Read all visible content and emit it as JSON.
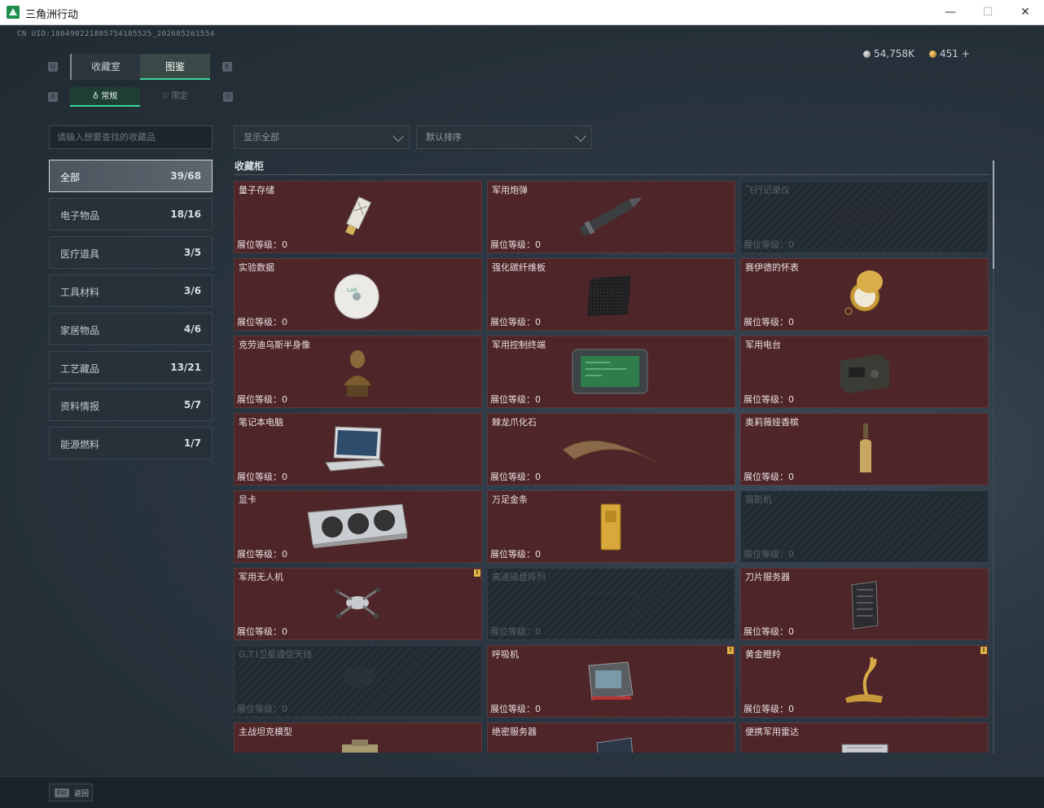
{
  "window": {
    "title": "三角洲行动",
    "minimize": "—",
    "maximize": "☐",
    "close": "✕"
  },
  "uid": "CN UID:1864902218057541055​25_202605261554",
  "currency": [
    {
      "icon": "silver-coin-icon",
      "value": "54,758K"
    },
    {
      "icon": "gold-coin-icon",
      "value": "451 +"
    }
  ],
  "tabs": {
    "main": [
      "收藏室",
      "图鉴"
    ],
    "main_active": 1,
    "sub": [
      "常规",
      "限定"
    ],
    "sub_active": 0,
    "hint_left": "Q",
    "hint_right": "E",
    "hint_left2": "A",
    "hint_right2": "D"
  },
  "search": {
    "placeholder": "请输入想要查找的收藏品"
  },
  "filters": {
    "display": "显示全部",
    "sort": "默认排序"
  },
  "categories": [
    {
      "label": "全部",
      "count": "39/68",
      "active": true
    },
    {
      "label": "电子物品",
      "count": "18/16"
    },
    {
      "label": "医疗道具",
      "count": "3/5"
    },
    {
      "label": "工具材料",
      "count": "3/6"
    },
    {
      "label": "家居物品",
      "count": "4/6"
    },
    {
      "label": "工艺藏品",
      "count": "13/21"
    },
    {
      "label": "资料情报",
      "count": "5/7"
    },
    {
      "label": "能源燃料",
      "count": "1/7"
    }
  ],
  "section": {
    "title": "收藏柜"
  },
  "level_label": "展位等级：0",
  "items": [
    {
      "name": "量子存储",
      "unlocked": true,
      "badge": false,
      "icon": "usb-drive-icon"
    },
    {
      "name": "军用炮弹",
      "unlocked": true,
      "badge": false,
      "icon": "artillery-shell-icon"
    },
    {
      "name": "飞行记录仪",
      "unlocked": false,
      "badge": false,
      "icon": "flight-recorder-icon"
    },
    {
      "name": "实验数据",
      "unlocked": true,
      "badge": false,
      "icon": "disc-icon"
    },
    {
      "name": "强化碳纤维板",
      "unlocked": true,
      "badge": false,
      "icon": "carbon-plate-icon"
    },
    {
      "name": "赛伊德的怀表",
      "unlocked": true,
      "badge": false,
      "icon": "pocket-watch-icon"
    },
    {
      "name": "克劳迪乌斯半身像",
      "unlocked": true,
      "badge": false,
      "icon": "bust-icon"
    },
    {
      "name": "军用控制终端",
      "unlocked": true,
      "badge": false,
      "icon": "control-terminal-icon"
    },
    {
      "name": "军用电台",
      "unlocked": true,
      "badge": false,
      "icon": "radio-icon"
    },
    {
      "name": "笔记本电脑",
      "unlocked": true,
      "badge": false,
      "icon": "laptop-icon"
    },
    {
      "name": "棘龙爪化石",
      "unlocked": true,
      "badge": false,
      "icon": "claw-fossil-icon"
    },
    {
      "name": "奥莉薇娅香槟",
      "unlocked": true,
      "badge": false,
      "icon": "champagne-icon"
    },
    {
      "name": "显卡",
      "unlocked": true,
      "badge": false,
      "icon": "graphics-card-icon"
    },
    {
      "name": "万足金条",
      "unlocked": true,
      "badge": false,
      "icon": "gold-bar-icon"
    },
    {
      "name": "摄影机",
      "unlocked": false,
      "badge": false,
      "icon": "camera-icon"
    },
    {
      "name": "军用无人机",
      "unlocked": true,
      "badge": true,
      "icon": "drone-icon"
    },
    {
      "name": "高速磁盘阵列",
      "unlocked": false,
      "badge": false,
      "icon": "disk-array-icon"
    },
    {
      "name": "刀片服务器",
      "unlocked": true,
      "badge": false,
      "icon": "blade-server-icon"
    },
    {
      "name": "G.T.I卫星通信天线",
      "unlocked": false,
      "badge": false,
      "icon": "satellite-dish-icon"
    },
    {
      "name": "呼吸机",
      "unlocked": true,
      "badge": true,
      "icon": "ventilator-icon"
    },
    {
      "name": "黄金瞪羚",
      "unlocked": true,
      "badge": true,
      "icon": "gold-gazelle-icon"
    },
    {
      "name": "主战坦克模型",
      "unlocked": true,
      "badge": false,
      "icon": "tank-model-icon"
    },
    {
      "name": "绝密服务器",
      "unlocked": true,
      "badge": false,
      "icon": "server-icon"
    },
    {
      "name": "便携军用雷达",
      "unlocked": true,
      "badge": false,
      "icon": "radar-icon"
    }
  ],
  "footer": {
    "esc_key": "Esc",
    "esc_label": "返回"
  }
}
